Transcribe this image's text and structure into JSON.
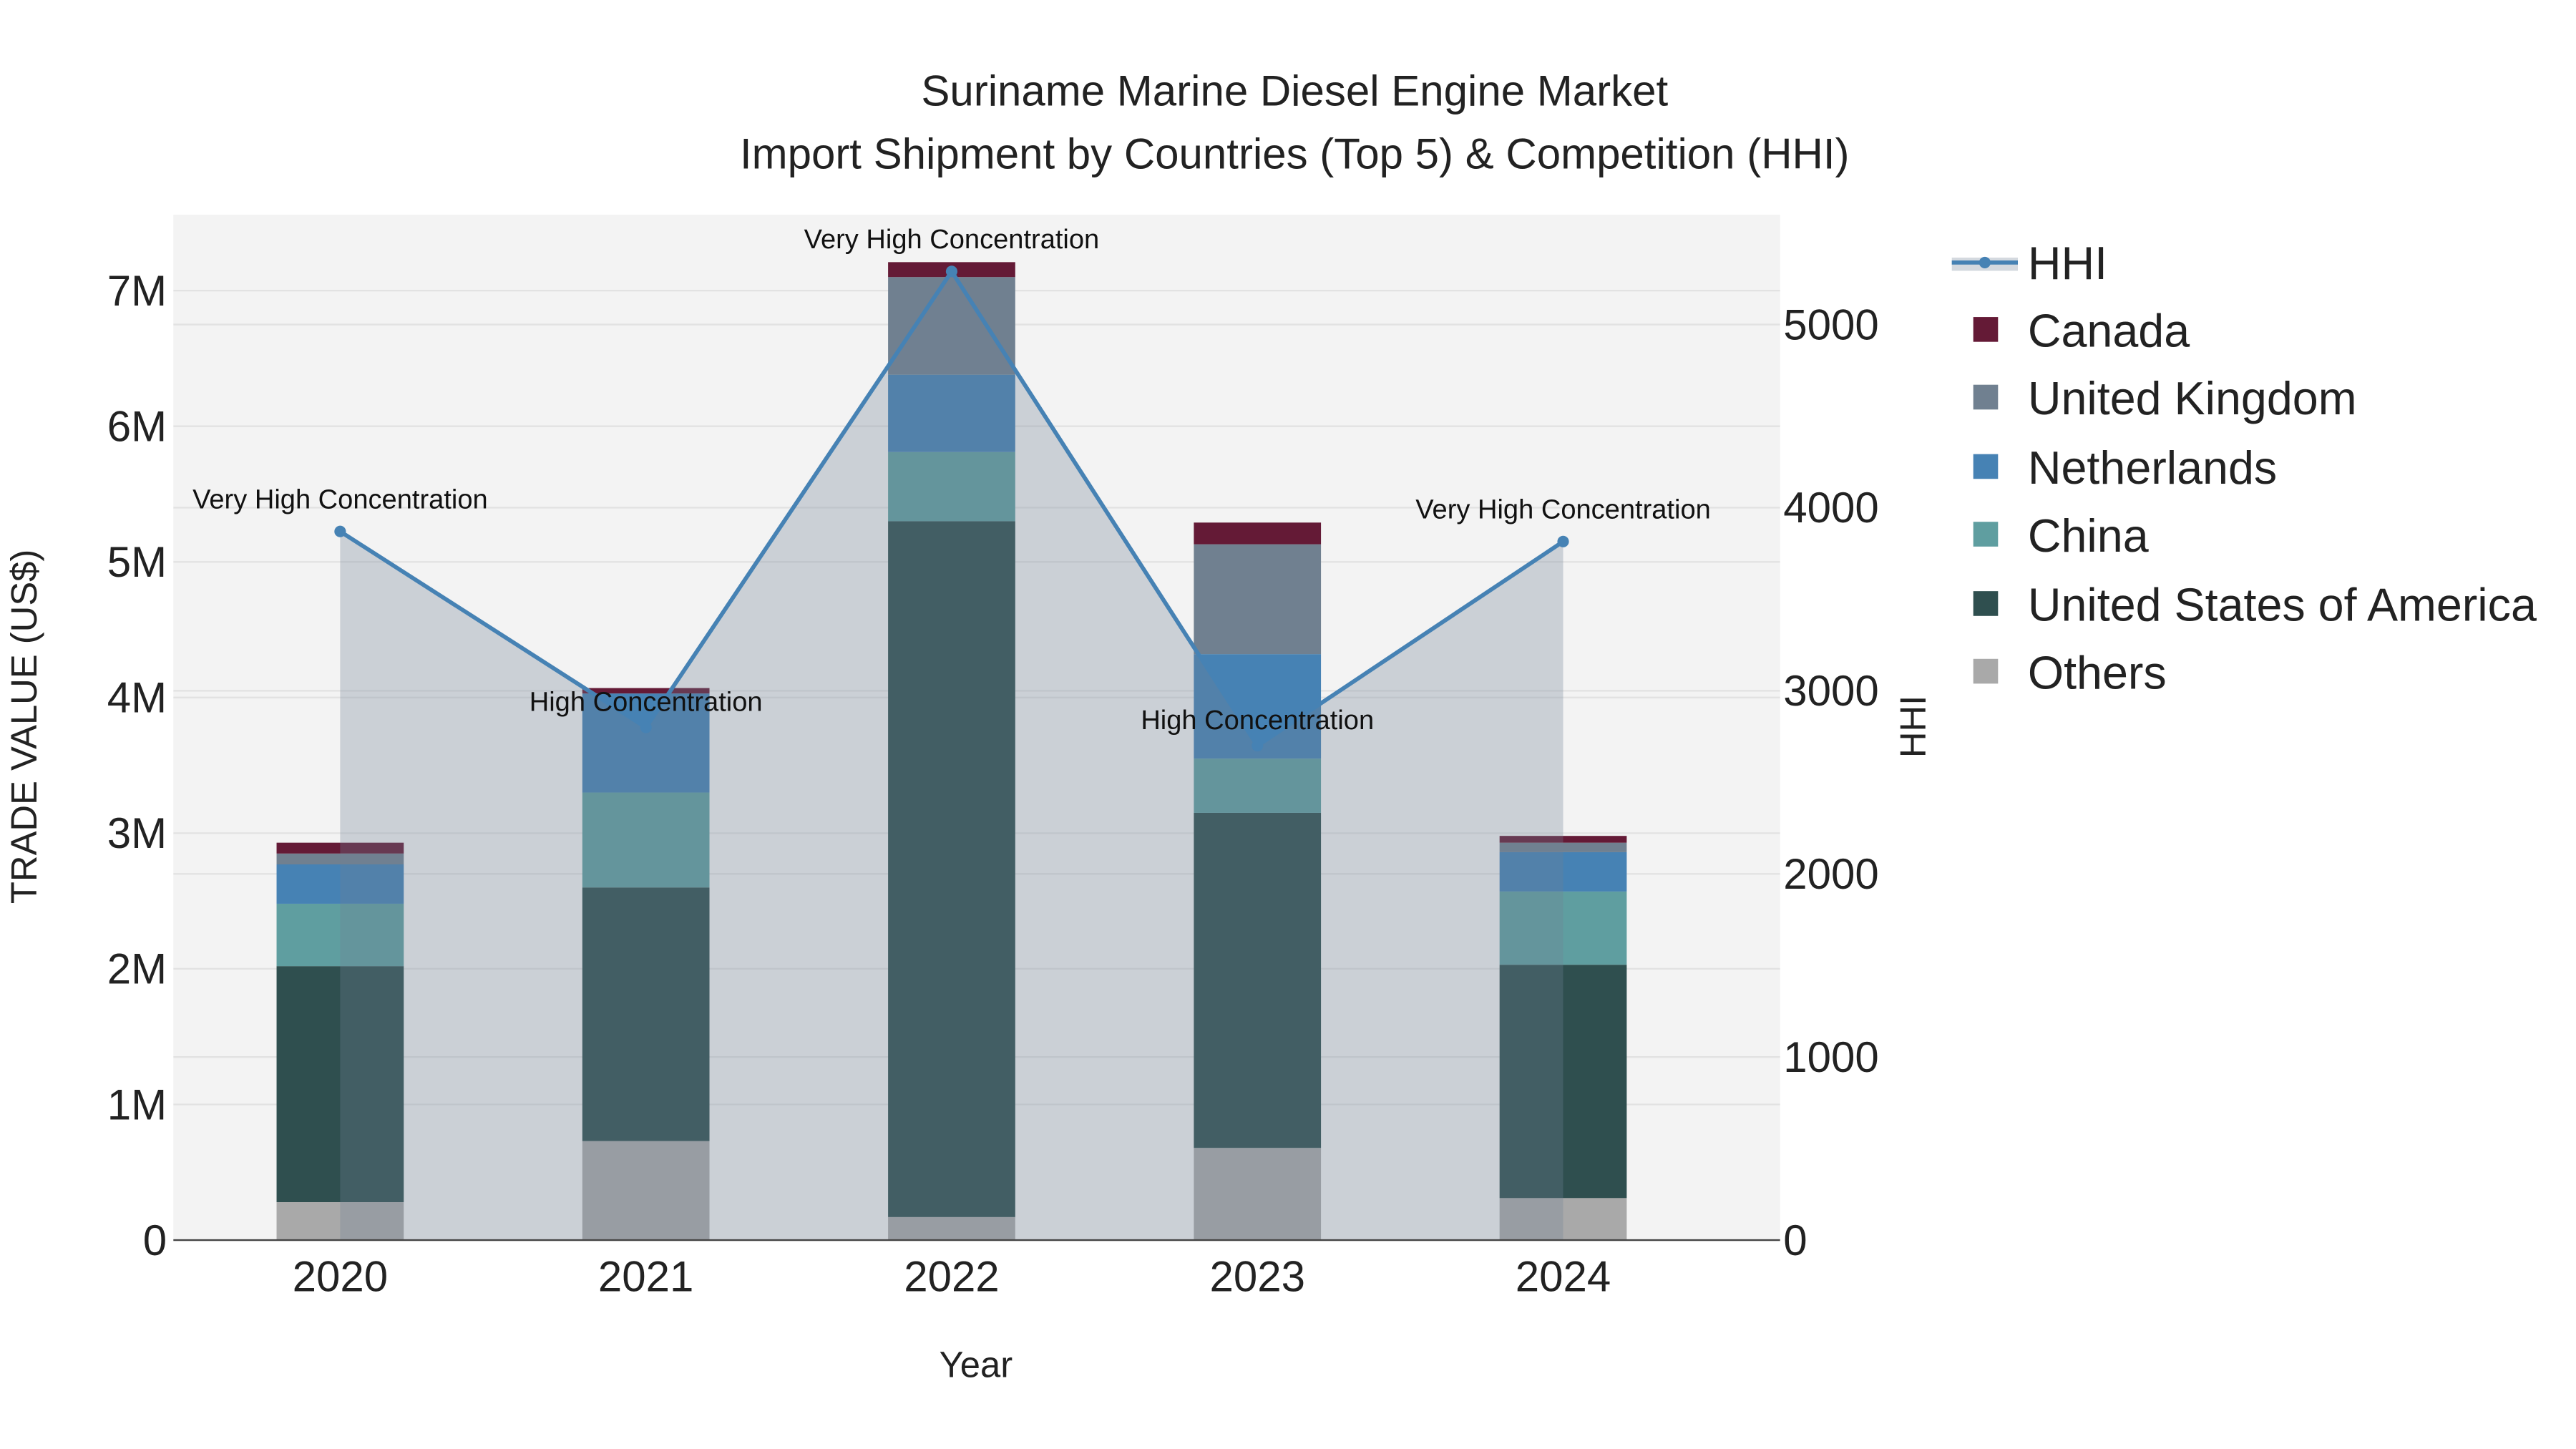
{
  "chart_data": {
    "type": "bar",
    "title": "Suriname Marine Diesel Engine Market",
    "subtitle": "Import Shipment by Countries (Top 5) & Competition (HHI)",
    "xlabel": "Year",
    "ylabel": "TRADE VALUE (US$)",
    "y2label": "HHI",
    "categories": [
      "2020",
      "2021",
      "2022",
      "2023",
      "2024"
    ],
    "ylim": [
      0,
      7560000
    ],
    "y2lim": [
      0,
      5600
    ],
    "yticks": [
      0,
      1000000,
      2000000,
      3000000,
      4000000,
      5000000,
      6000000,
      7000000
    ],
    "ytick_labels": [
      "0",
      "1M",
      "2M",
      "3M",
      "4M",
      "5M",
      "6M",
      "7M"
    ],
    "y2ticks": [
      0,
      1000,
      2000,
      3000,
      4000,
      5000
    ],
    "y2tick_labels": [
      "0",
      "1000",
      "2000",
      "3000",
      "4000",
      "5000"
    ],
    "stacked": true,
    "series": [
      {
        "name": "Others",
        "color": "#a9a9a9",
        "values": [
          280000,
          730000,
          170000,
          680000,
          310000
        ]
      },
      {
        "name": "United States of America",
        "color": "#2f4f4f",
        "values": [
          1740000,
          1870000,
          5130000,
          2470000,
          1720000
        ]
      },
      {
        "name": "China",
        "color": "#5f9ea0",
        "values": [
          460000,
          700000,
          510000,
          400000,
          540000
        ]
      },
      {
        "name": "Netherlands",
        "color": "#4682b4",
        "values": [
          290000,
          730000,
          570000,
          770000,
          290000
        ]
      },
      {
        "name": "United Kingdom",
        "color": "#708090",
        "values": [
          80000,
          0,
          720000,
          810000,
          70000
        ]
      },
      {
        "name": "Canada",
        "color": "#641a36",
        "values": [
          80000,
          40000,
          110000,
          160000,
          50000
        ]
      }
    ],
    "hhi": {
      "name": "HHI",
      "color": "#4682b4",
      "values": [
        3870,
        2800,
        5290,
        2700,
        3815
      ]
    },
    "annotations": [
      "Very High Concentration",
      "High Concentration",
      "Very High Concentration",
      "High Concentration",
      "Very High Concentration"
    ],
    "legend": [
      "HHI",
      "Canada",
      "United Kingdom",
      "Netherlands",
      "China",
      "United States of America",
      "Others"
    ],
    "legend_position": "right",
    "grid": true
  }
}
